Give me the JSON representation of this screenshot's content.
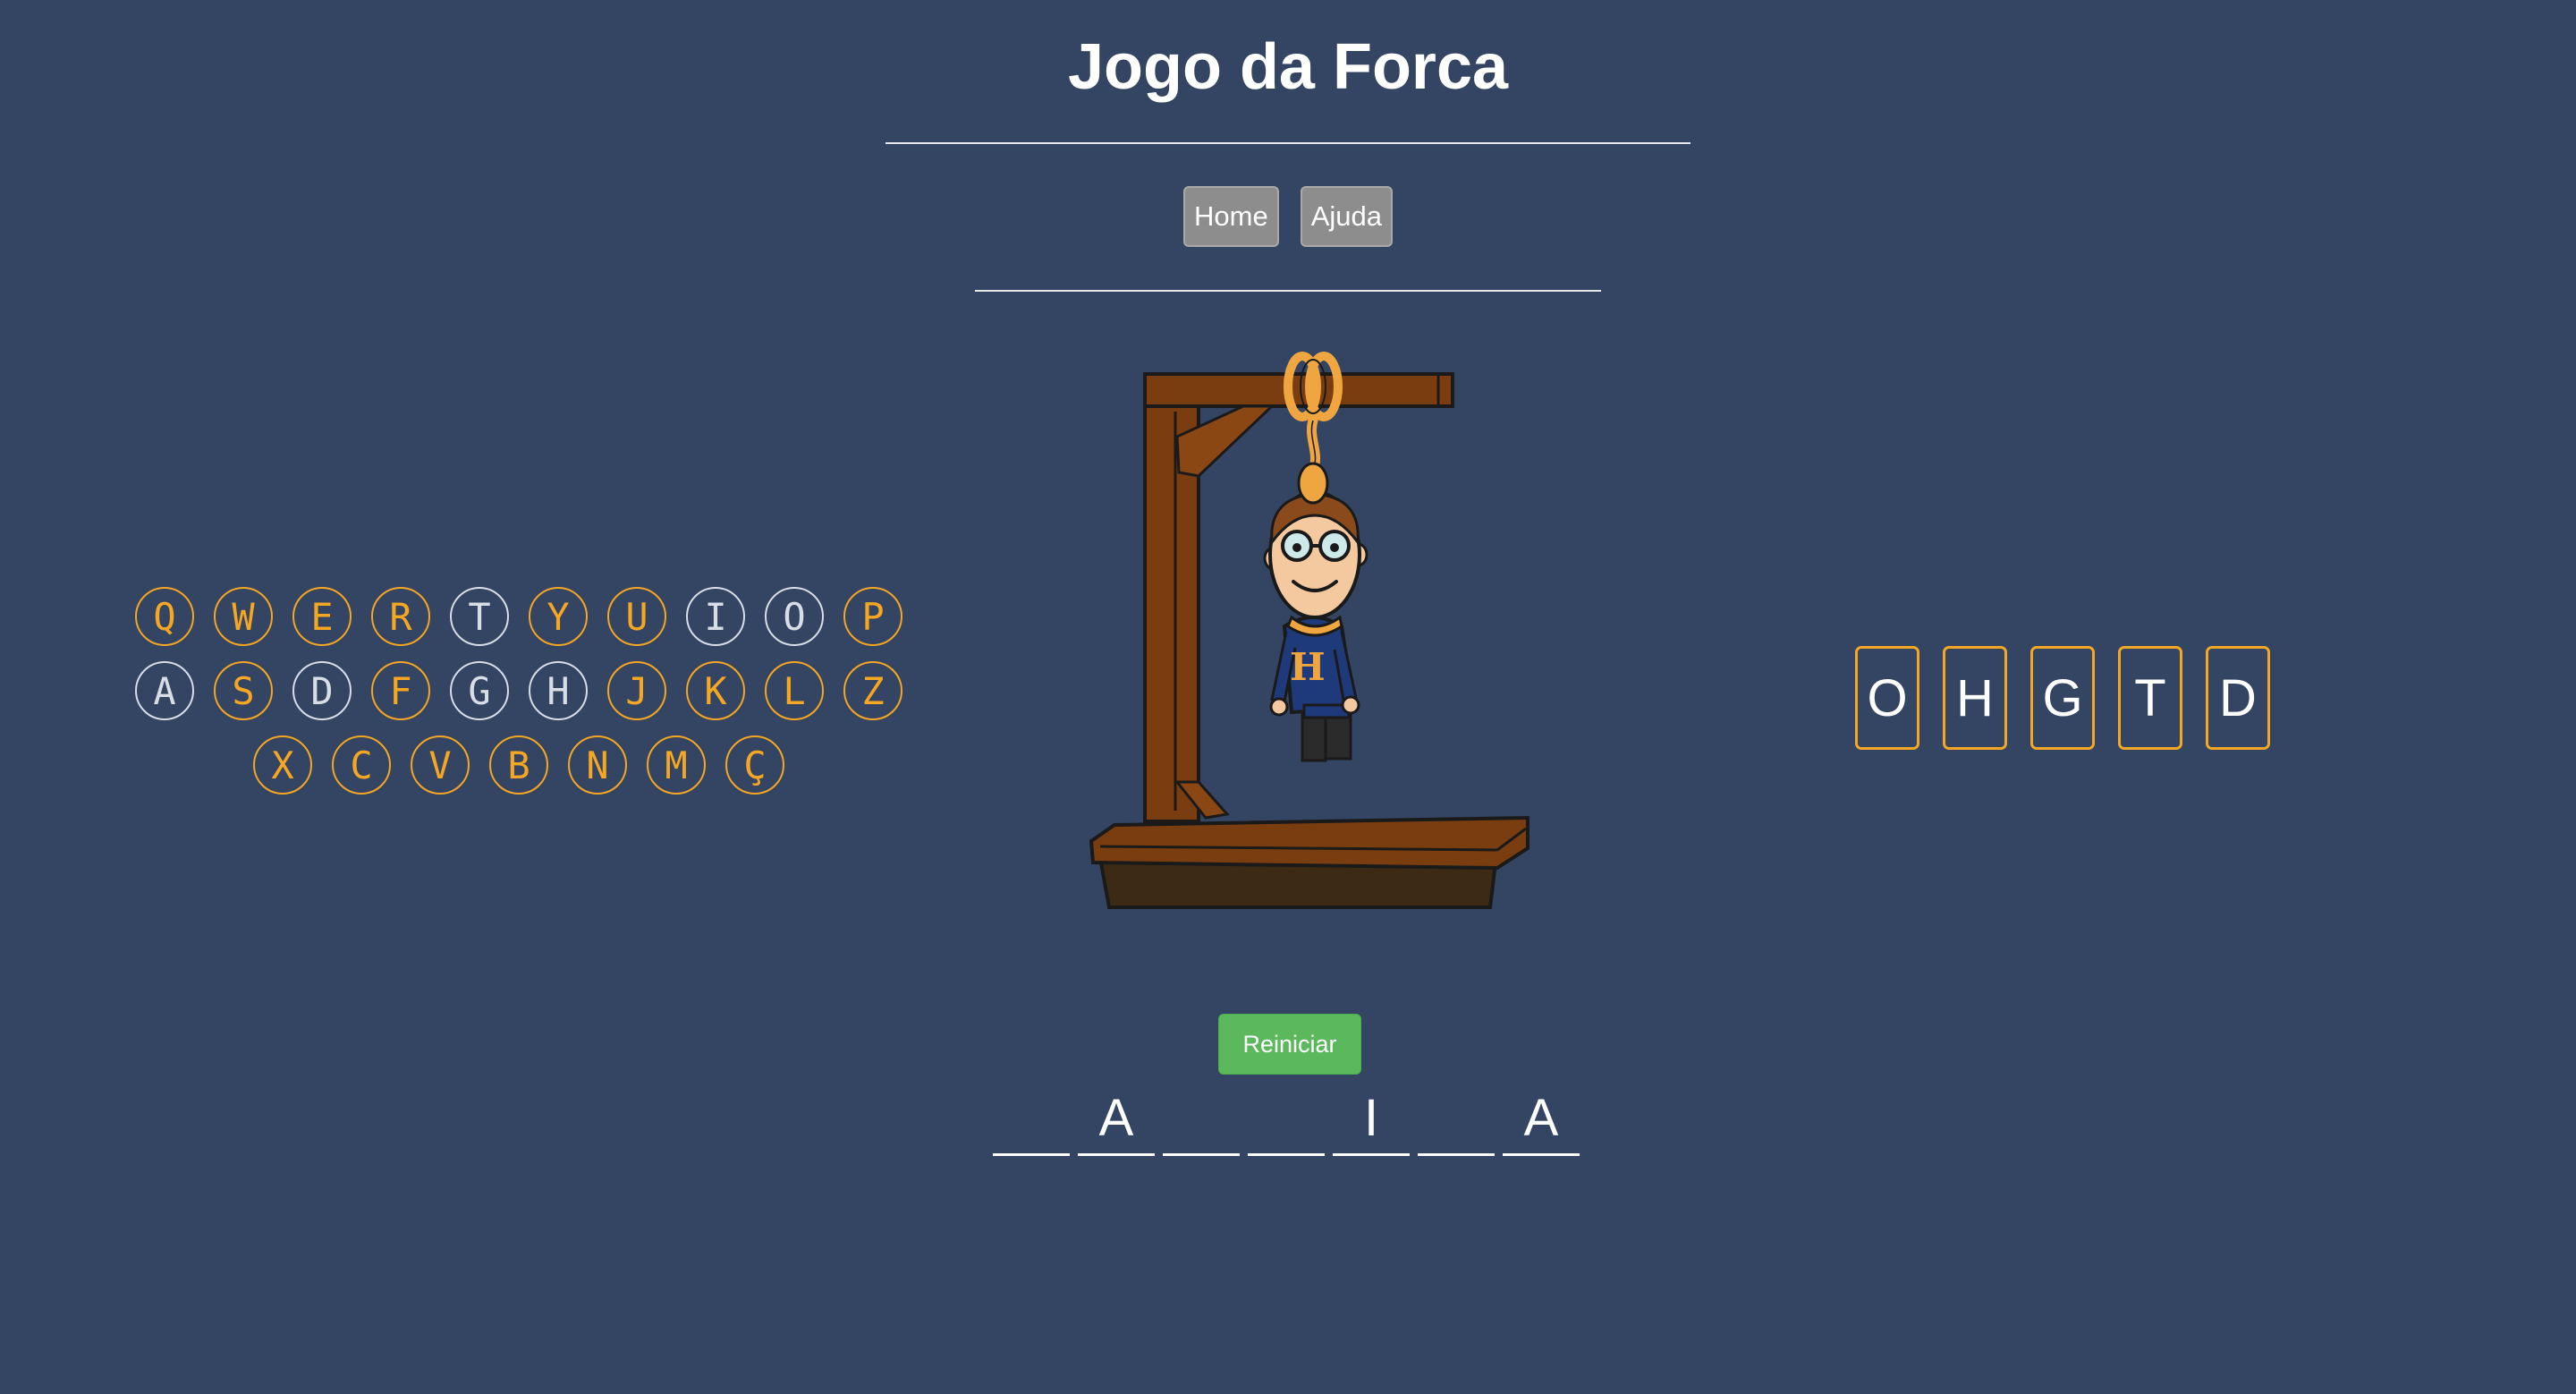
{
  "header": {
    "title": "Jogo da Forca"
  },
  "nav": {
    "home_label": "Home",
    "help_label": "Ajuda"
  },
  "keyboard": {
    "rows": [
      [
        {
          "letter": "Q",
          "used": false
        },
        {
          "letter": "W",
          "used": false
        },
        {
          "letter": "E",
          "used": false
        },
        {
          "letter": "R",
          "used": false
        },
        {
          "letter": "T",
          "used": true
        },
        {
          "letter": "Y",
          "used": false
        },
        {
          "letter": "U",
          "used": false
        },
        {
          "letter": "I",
          "used": true
        },
        {
          "letter": "O",
          "used": true
        },
        {
          "letter": "P",
          "used": false
        }
      ],
      [
        {
          "letter": "A",
          "used": true
        },
        {
          "letter": "S",
          "used": false
        },
        {
          "letter": "D",
          "used": true
        },
        {
          "letter": "F",
          "used": false
        },
        {
          "letter": "G",
          "used": true
        },
        {
          "letter": "H",
          "used": true
        },
        {
          "letter": "J",
          "used": false
        },
        {
          "letter": "K",
          "used": false
        },
        {
          "letter": "L",
          "used": false
        },
        {
          "letter": "Z",
          "used": false
        }
      ],
      [
        {
          "letter": "X",
          "used": false
        },
        {
          "letter": "C",
          "used": false
        },
        {
          "letter": "V",
          "used": false
        },
        {
          "letter": "B",
          "used": false
        },
        {
          "letter": "N",
          "used": false
        },
        {
          "letter": "M",
          "used": false
        },
        {
          "letter": "Ç",
          "used": false
        }
      ]
    ]
  },
  "gallows": {
    "sweater_letter": "H"
  },
  "wrong_letters": [
    "O",
    "H",
    "G",
    "T",
    "D"
  ],
  "restart_label": "Reiniciar",
  "word_slots": [
    "",
    "A",
    "",
    "",
    "I",
    "",
    "A"
  ],
  "colors": {
    "background": "#344563",
    "accent": "#f5a623",
    "used_key": "#d8dde6",
    "nav_button": "#8d8d8d",
    "restart": "#5cb85c"
  }
}
